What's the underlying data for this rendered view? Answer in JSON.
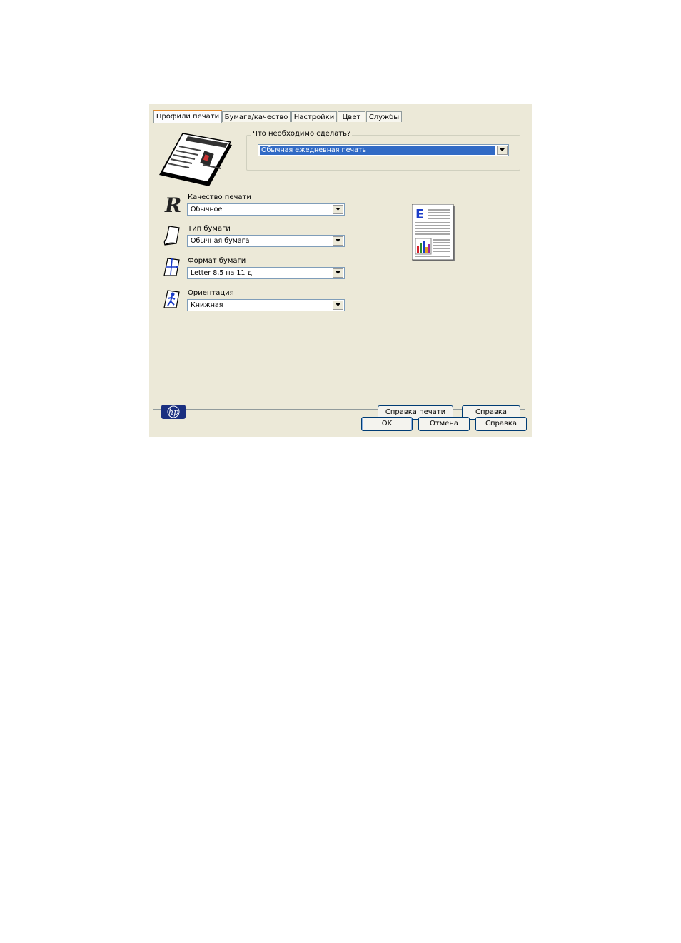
{
  "tabs": [
    {
      "label": "Профили печати",
      "active": true
    },
    {
      "label": "Бумага/качество",
      "active": false
    },
    {
      "label": "Настройки",
      "active": false
    },
    {
      "label": "Цвет",
      "active": false
    },
    {
      "label": "Службы",
      "active": false
    }
  ],
  "task": {
    "group_label": "Что необходимо сделать?",
    "selected": "Обычная ежедневная печать"
  },
  "fields": {
    "quality": {
      "label": "Качество печати",
      "value": "Обычное",
      "icon": "print-quality-icon"
    },
    "paper_type": {
      "label": "Тип бумаги",
      "value": "Обычная бумага",
      "icon": "paper-type-icon"
    },
    "paper_size": {
      "label": "Формат бумаги",
      "value": "Letter 8,5 на 11 д.",
      "icon": "paper-size-icon"
    },
    "orientation": {
      "label": "Ориентация",
      "value": "Книжная",
      "icon": "orientation-icon"
    }
  },
  "panel_buttons": {
    "print_help": "Справка печати",
    "help": "Справка"
  },
  "dialog_buttons": {
    "ok": "OK",
    "cancel": "Отмена",
    "help": "Справка"
  },
  "colors": {
    "dialog_bg": "#ece9d8",
    "selection": "#316ac5",
    "active_tab_accent": "#e68b2c",
    "hp_blue": "#1a2f80"
  }
}
